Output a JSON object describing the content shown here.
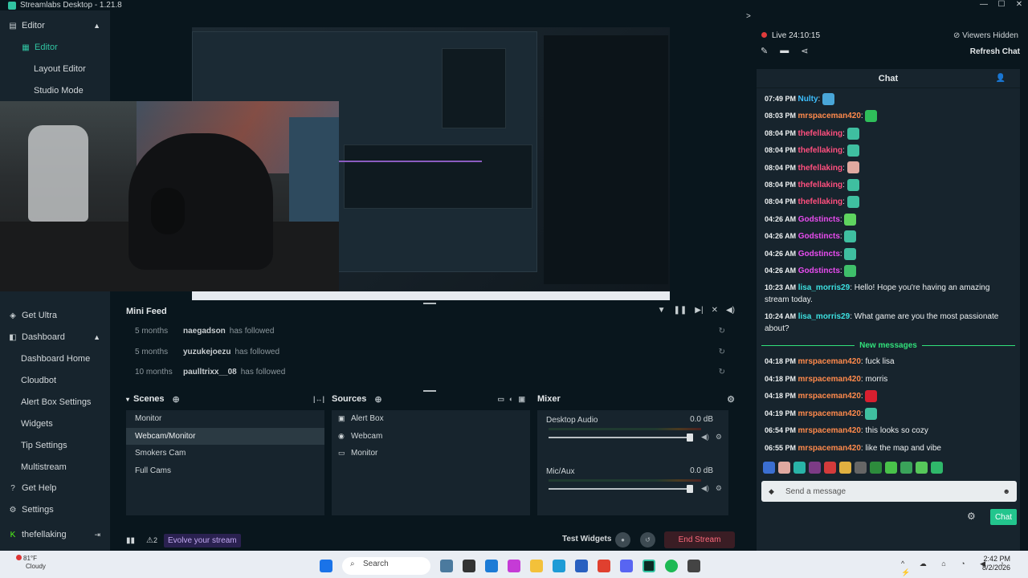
{
  "app": {
    "title": "Streamlabs Desktop - 1.21.8"
  },
  "window_controls": [
    "—",
    "☐",
    "✕"
  ],
  "sidebar": {
    "editor_group": "Editor",
    "editor": "Editor",
    "layout_editor": "Layout Editor",
    "studio_mode": "Studio Mode",
    "get_ultra": "Get Ultra",
    "dashboard_group": "Dashboard",
    "dashboard_home": "Dashboard Home",
    "cloudbot": "Cloudbot",
    "alert_box_settings": "Alert Box Settings",
    "widgets": "Widgets",
    "tip_settings": "Tip Settings",
    "multistream": "Multistream",
    "get_help": "Get Help",
    "settings": "Settings",
    "user": "thefellaking"
  },
  "mini_feed": {
    "title": "Mini Feed",
    "rows": [
      {
        "age": "5 months",
        "user": "naegadson",
        "action": "has followed"
      },
      {
        "age": "5 months",
        "user": "yuzukejoezu",
        "action": "has followed"
      },
      {
        "age": "10 months",
        "user": "paulltrixx__08",
        "action": "has followed"
      }
    ]
  },
  "scenes": {
    "title": "Scenes",
    "items": [
      "Monitor",
      "Webcam/Monitor",
      "Smokers Cam",
      "Full Cams"
    ],
    "selected": "Webcam/Monitor"
  },
  "sources": {
    "title": "Sources",
    "items": [
      "Alert Box",
      "Webcam",
      "Monitor"
    ]
  },
  "mixer": {
    "title": "Mixer",
    "channels": [
      {
        "name": "Desktop Audio",
        "db": "0.0 dB",
        "level": 1.0
      },
      {
        "name": "Mic/Aux",
        "db": "0.0 dB",
        "level": 1.0
      }
    ]
  },
  "footer": {
    "badge_count": "2",
    "evolve": "Evolve your stream",
    "test_widgets": "Test Widgets",
    "end_stream": "End Stream"
  },
  "stream": {
    "live": "Live 24:10:15",
    "viewers_hidden": "Viewers Hidden",
    "refresh_chat": "Refresh Chat"
  },
  "chat": {
    "title": "Chat",
    "new_messages": "New messages",
    "placeholder": "Send a message",
    "send_label": "Chat",
    "messages": [
      {
        "time": "07:49 PM",
        "user": "Nulty",
        "color": "#3dbfff",
        "text": ""
      },
      {
        "time": "08:03 PM",
        "user": "mrspaceman420",
        "color": "#ff8a4c",
        "text": ""
      },
      {
        "time": "08:04 PM",
        "user": "thefellaking",
        "color": "#ff4f7e",
        "text": ""
      },
      {
        "time": "08:04 PM",
        "user": "thefellaking",
        "color": "#ff4f7e",
        "text": ""
      },
      {
        "time": "08:04 PM",
        "user": "thefellaking",
        "color": "#ff4f7e",
        "text": ""
      },
      {
        "time": "08:04 PM",
        "user": "thefellaking",
        "color": "#ff4f7e",
        "text": ""
      },
      {
        "time": "08:04 PM",
        "user": "thefellaking",
        "color": "#ff4f7e",
        "text": ""
      },
      {
        "time": "04:26 AM",
        "user": "Godstincts",
        "color": "#e94cf0",
        "text": ""
      },
      {
        "time": "04:26 AM",
        "user": "Godstincts",
        "color": "#e94cf0",
        "text": ""
      },
      {
        "time": "04:26 AM",
        "user": "Godstincts",
        "color": "#e94cf0",
        "text": ""
      },
      {
        "time": "04:26 AM",
        "user": "Godstincts",
        "color": "#e94cf0",
        "text": ""
      },
      {
        "time": "10:23 AM",
        "user": "lisa_morris29",
        "color": "#3de0e0",
        "text": "Hello! Hope you're having an amazing stream today."
      },
      {
        "time": "10:24 AM",
        "user": "lisa_morris29",
        "color": "#3de0e0",
        "text": "What game are you the most passionate about?"
      }
    ],
    "new": [
      {
        "time": "04:18 PM",
        "user": "mrspaceman420",
        "color": "#ff8a4c",
        "text": "fuck lisa"
      },
      {
        "time": "04:18 PM",
        "user": "mrspaceman420",
        "color": "#ff8a4c",
        "text": "morris"
      },
      {
        "time": "04:18 PM",
        "user": "mrspaceman420",
        "color": "#ff8a4c",
        "text": ""
      },
      {
        "time": "04:19 PM",
        "user": "mrspaceman420",
        "color": "#ff8a4c",
        "text": ""
      },
      {
        "time": "06:54 PM",
        "user": "mrspaceman420",
        "color": "#ff8a4c",
        "text": "this looks so cozy"
      },
      {
        "time": "06:55 PM",
        "user": "mrspaceman420",
        "color": "#ff8a4c",
        "text": "like the map and vibe"
      }
    ]
  },
  "taskbar": {
    "temp": "81°F",
    "cond": "Cloudy",
    "search": "Search",
    "time": "2:42 PM",
    "date": "8/2/2026"
  }
}
